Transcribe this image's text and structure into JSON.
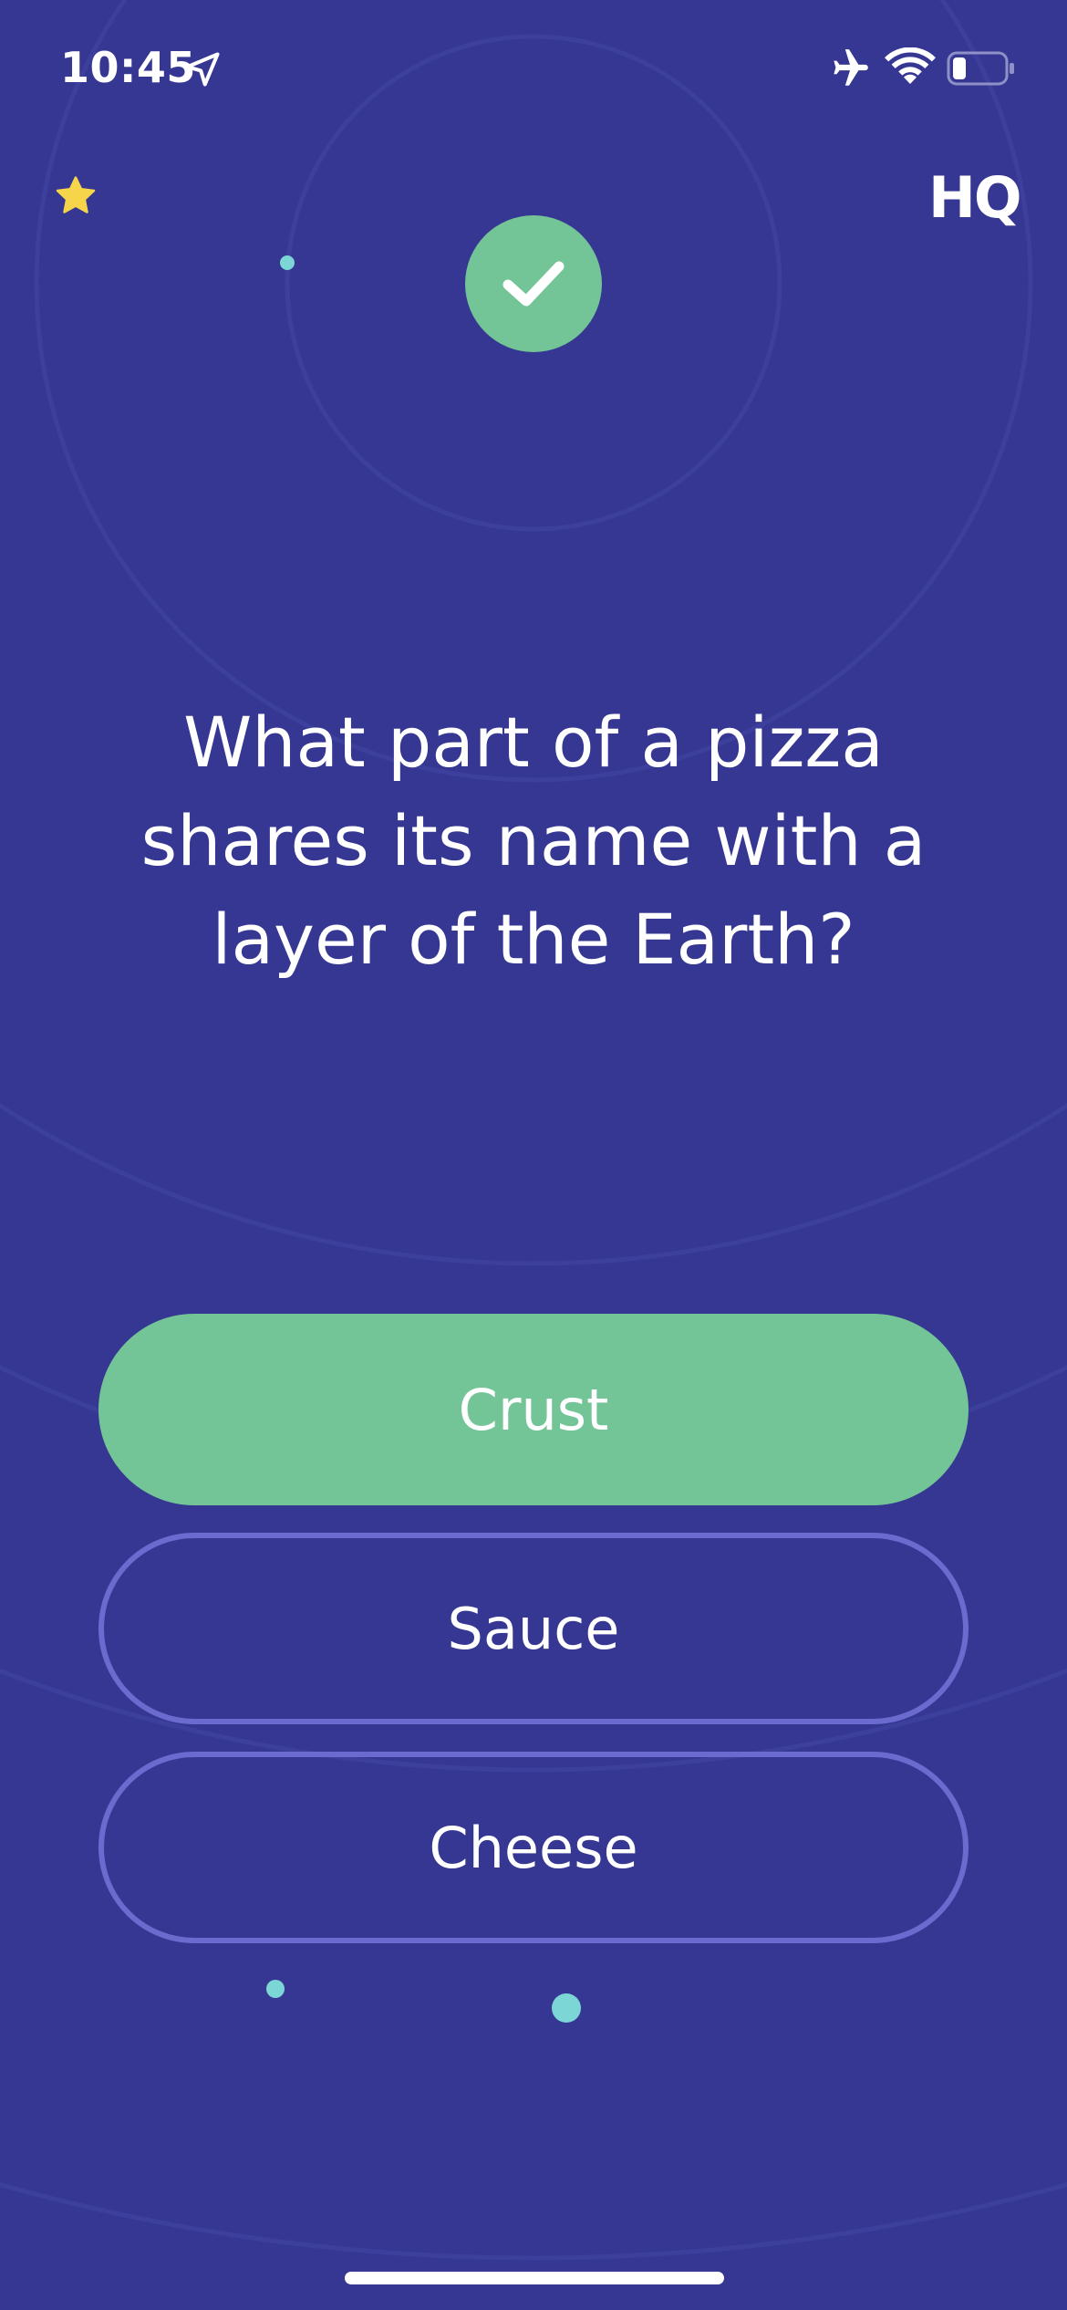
{
  "status_bar": {
    "time": "10:45"
  },
  "header": {
    "logo_text": "HQ",
    "star_color": "#f7d54a",
    "result_icon": "check-icon",
    "result_color": "#73c496"
  },
  "question": {
    "text": "What part of a pizza shares its name with a layer of the Earth?"
  },
  "answers": [
    {
      "label": "Crust",
      "state": "correct"
    },
    {
      "label": "Sauce",
      "state": "unselected"
    },
    {
      "label": "Cheese",
      "state": "unselected"
    }
  ],
  "colors": {
    "background": "#353793",
    "correct": "#73c496",
    "outline": "#6a6acf",
    "accent_dot": "#7dd6d6"
  }
}
